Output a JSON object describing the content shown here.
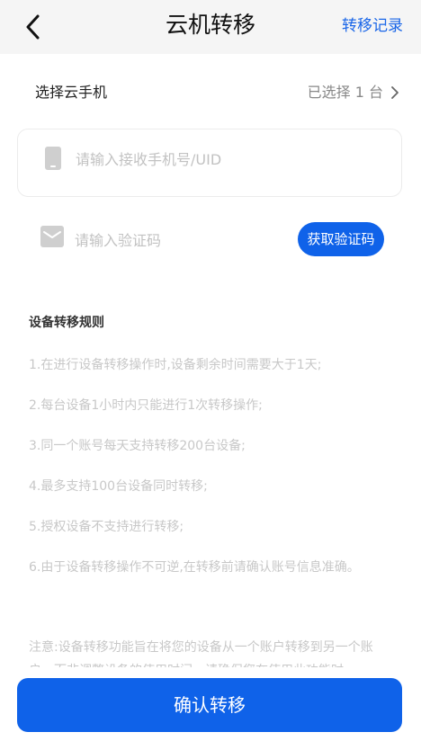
{
  "header": {
    "title": "云机转移",
    "record_link": "转移记录"
  },
  "select_phone": {
    "label": "选择云手机",
    "value": "已选择 1 台"
  },
  "receiver_input": {
    "placeholder": "请输入接收手机号/UID",
    "value": ""
  },
  "code_input": {
    "placeholder": "请输入验证码",
    "value": ""
  },
  "get_code_button": "获取验证码",
  "rules": {
    "title": "设备转移规则",
    "items": [
      "1.在进行设备转移操作时,设备剩余时间需要大于1天;",
      "2.每台设备1小时内只能进行1次转移操作;",
      "3.同一个账号每天支持转移200台设备;",
      "4.最多支持100台设备同时转移;",
      "5.授权设备不支持进行转移;",
      "6.由于设备转移操作不可逆,在转移前请确认账号信息准确。"
    ]
  },
  "note": "注意:设备转移功能旨在将您的设备从一个账户转移到另一个账户，而非调整设备的使用时间，请确保您在使用此功能时",
  "confirm_button": "确认转移",
  "colors": {
    "primary": "#0f62e9",
    "link": "#1a66e8",
    "placeholder": "#c2c2c2",
    "rule_text": "#c8c8c8"
  },
  "icons": {
    "back": "chevron-left-icon",
    "chevron": "chevron-right-icon",
    "phone": "phone-icon",
    "mail": "mail-icon"
  }
}
